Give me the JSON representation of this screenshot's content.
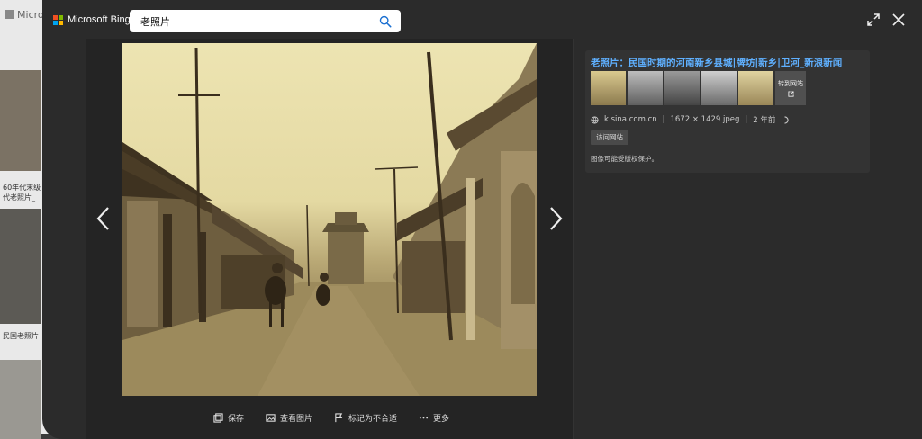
{
  "background": {
    "logo_text": "Micro",
    "captions": [
      "60年代末级",
      "代老照片_",
      "民国老照片"
    ]
  },
  "brand": {
    "name": "Microsoft Bing"
  },
  "search": {
    "value": "老照片"
  },
  "info": {
    "title": "老照片：民国时期的河南新乡县城|牌坊|新乡|卫河_新浪新闻",
    "goto_site": "转到网站",
    "source": "k.sina.com.cn",
    "size": "1672 × 1429 jpeg",
    "age": "2 年前",
    "visit_button": "访问网站",
    "copyright": "图像可能受版权保护。"
  },
  "actions": {
    "save": "保存",
    "view_image": "查看图片",
    "flag": "标记为不合适",
    "more": "更多"
  },
  "colors": {
    "link": "#5fb0ff",
    "modal": "#2b2b2b",
    "panel": "#333333"
  }
}
